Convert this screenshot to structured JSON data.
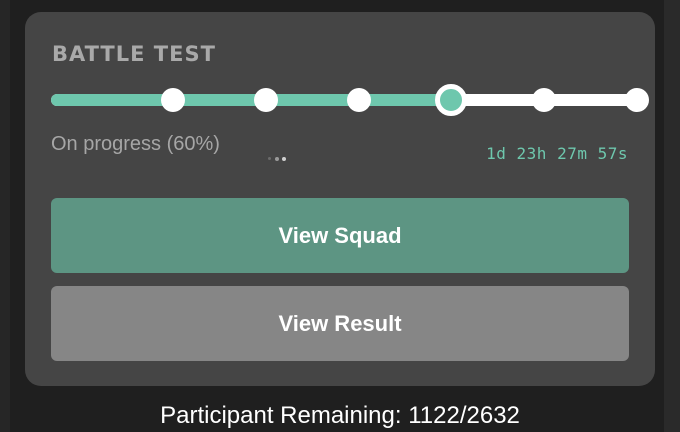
{
  "card": {
    "title": "BATTLE TEST",
    "progress": {
      "percent": 60,
      "total_steps": 6,
      "current_step": 4,
      "status_text": "On progress (60%)",
      "countdown": "1d 23h 27m 57s"
    },
    "buttons": {
      "view_squad": "View Squad",
      "view_result": "View Result"
    }
  },
  "footer": {
    "participants": "Participant Remaining: 1122/2632"
  },
  "colors": {
    "accent": "#6ec7ad",
    "squad_button": "#5d9583",
    "result_button": "#868686",
    "card_bg": "#454545"
  }
}
